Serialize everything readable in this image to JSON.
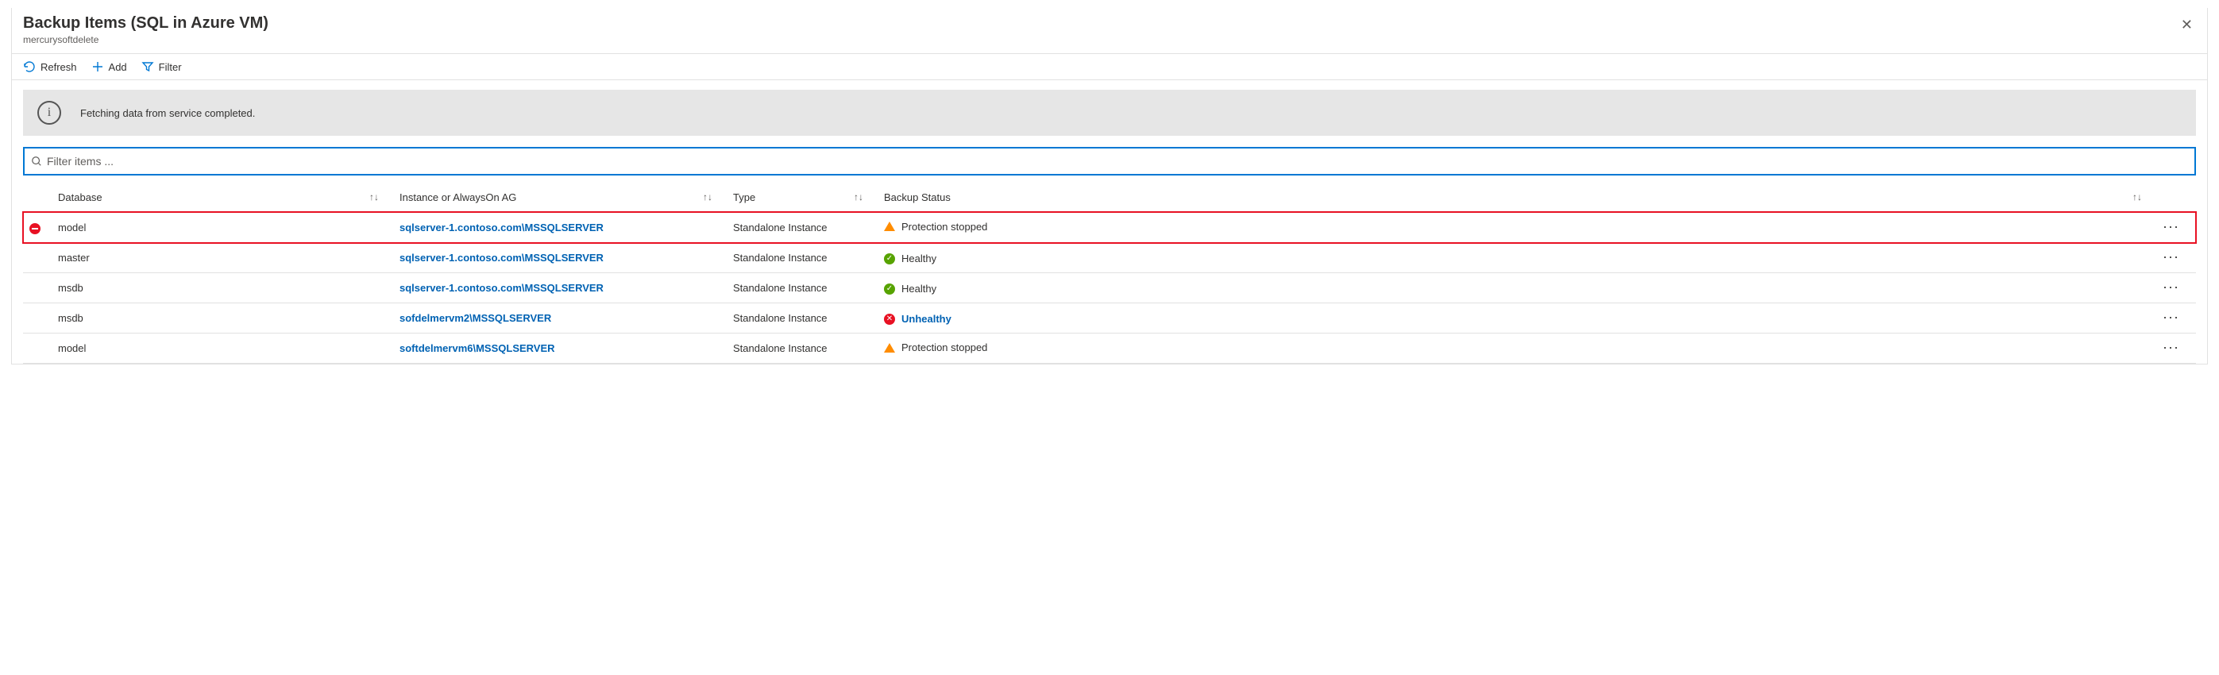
{
  "header": {
    "title": "Backup Items (SQL in Azure VM)",
    "subtitle": "mercurysoftdelete"
  },
  "toolbar": {
    "refresh": "Refresh",
    "add": "Add",
    "filter": "Filter"
  },
  "infoBar": {
    "message": "Fetching data from service completed."
  },
  "filterItems": {
    "placeholder": "Filter items ..."
  },
  "columns": {
    "database": "Database",
    "instance": "Instance or AlwaysOn AG",
    "type": "Type",
    "status": "Backup Status"
  },
  "statusLabels": {
    "protection_stopped": "Protection stopped",
    "healthy": "Healthy",
    "unhealthy": "Unhealthy"
  },
  "rows": [
    {
      "database": "model",
      "instance": "sqlserver-1.contoso.com\\MSSQLSERVER",
      "type": "Standalone Instance",
      "status": "protection_stopped",
      "highlighted": true,
      "deleteMark": true
    },
    {
      "database": "master",
      "instance": "sqlserver-1.contoso.com\\MSSQLSERVER",
      "type": "Standalone Instance",
      "status": "healthy"
    },
    {
      "database": "msdb",
      "instance": "sqlserver-1.contoso.com\\MSSQLSERVER",
      "type": "Standalone Instance",
      "status": "healthy"
    },
    {
      "database": "msdb",
      "instance": "sofdelmervm2\\MSSQLSERVER",
      "type": "Standalone Instance",
      "status": "unhealthy"
    },
    {
      "database": "model",
      "instance": "softdelmervm6\\MSSQLSERVER",
      "type": "Standalone Instance",
      "status": "protection_stopped"
    }
  ]
}
